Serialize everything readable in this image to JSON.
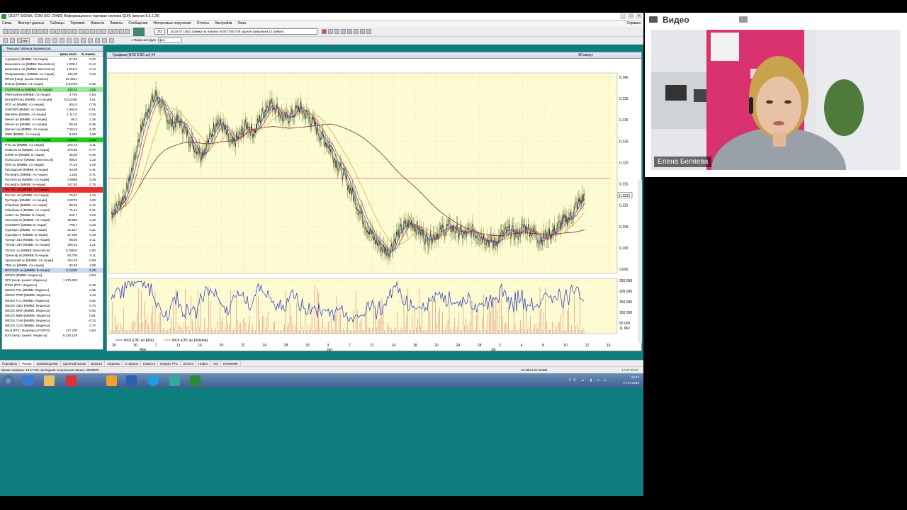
{
  "app": {
    "title": "[30277 SIGNAL-COM UID: 20483] Информационно-торговая система QUIK (версия 6.5.1.28)",
    "menu": [
      "Связь",
      "Экспорт данных",
      "Таблицы",
      "Торговля",
      "Новости",
      "Лимиты",
      "Сообщения",
      "Нетор­говые поручения",
      "Отчеты",
      "Настройки",
      "Окна"
    ],
    "help": "Справка",
    "news_counter": "2/2",
    "news_text": "15:16:47 (162) Заявка на покупку N 9477004728 зарегистрирована (3 заявки)",
    "search_label": "Поиск инструм",
    "search_value": "фск",
    "toolbar_dropdown": "МВБ"
  },
  "table": {
    "title": "Текущая таблица параметров",
    "headers": {
      "name": "",
      "price": "Цена посл.",
      "change": "% измен."
    },
    "rows": [
      {
        "name": "Аэрофлот [ММВБ: А2-Акции]",
        "price": "57,93",
        "change": "0,22"
      },
      {
        "name": "Башнефть ао [ММВБ: Внесписок]",
        "price": "1 005,2",
        "change": "-0,44"
      },
      {
        "name": "Башнефть ап [ММВБ: Внесписок]",
        "price": "2 019,5",
        "change": "0,14"
      },
      {
        "name": "Газпромнефть [ММВБ: А1-Акции]",
        "price": "122,00",
        "change": "0,23"
      },
      {
        "name": "RRUS [неор. рынки: Валюты]",
        "price": "32,4814",
        "change": ""
      },
      {
        "name": "ВТБ ао [ММВБ: А1-Акции]",
        "price": "0,04783",
        "change": "-0,36"
      },
      {
        "name": "ГАЗПРОМ ао [ММВБ: А1-Акции]",
        "price": "128,34",
        "change": "2,85",
        "hl": "#9de89d"
      },
      {
        "name": "ГМКНорНик [ММВБ: А2-Акции]",
        "price": "4 740",
        "change": "0,64"
      },
      {
        "name": "ИнтерРАОао [ММВБ: А1-Акции]",
        "price": "0,013400",
        "change": "1,51"
      },
      {
        "name": "ЛСР ао [ММВБ: А1-Акции]",
        "price": "604,0",
        "change": "0,78"
      },
      {
        "name": "ЛУКОЙЛ [ММВБ: А1-Акции]",
        "price": "1 994,8",
        "change": "-0,01"
      },
      {
        "name": "МегаФон [ММВБ: А1-Акции]",
        "price": "1 117,0",
        "change": "0,34"
      },
      {
        "name": "Мечел ап [ММВБ: А1-Акции]",
        "price": "96,3",
        "change": "1,16"
      },
      {
        "name": "Мечел ао [ММВБ: А1-Акции]",
        "price": "55,69",
        "change": "-0,36"
      },
      {
        "name": "Магнит ао [ММВБ: А1-Акции]",
        "price": "7 311,9",
        "change": "-1,32"
      },
      {
        "name": "ММК [ММВБ: А1-Акции]",
        "price": "8,240",
        "change": "1,98"
      },
      {
        "name": "+Носимаяго [ММВБ: А1-Акции]",
        "price": "1,0543",
        "change": "0,42",
        "hl": "#22cc22"
      },
      {
        "name": "НТС ао [ММВБ: А1-Акции]",
        "price": "272,73",
        "change": "0,11"
      },
      {
        "name": "Новатэк ао [ММВБ: А1-Акции]",
        "price": "370,80",
        "change": "0,77"
      },
      {
        "name": "НЛМК ао [ММВБ: Б-Акции]",
        "price": "46,60",
        "change": "-0,45"
      },
      {
        "name": "ПолюсЗолот [ММВБ: Внесписок]",
        "price": "905,0",
        "change": "1,22"
      },
      {
        "name": "ПИК ао [ММВБ: А1-Акции]",
        "price": "71,10",
        "change": "-1,46"
      },
      {
        "name": "Распадская [ММВБ: Б-Акции]",
        "price": "33,89",
        "change": "0,41"
      },
      {
        "name": "Роснефть [ММВБ: А1-Акции]",
        "price": "1,155",
        "change": "4,71"
      },
      {
        "name": "Россети ао [ММВБ: А2-Акции]",
        "price": "0,8888",
        "change": "2,29"
      },
      {
        "name": "Роснефть [ММВБ: Б-Акции]",
        "price": "247,83",
        "change": "0,75"
      },
      {
        "name": "Ростел- ао [ММВБ: А1-Акции]",
        "price": "",
        "change": "",
        "hl": "#e83030"
      },
      {
        "name": "Ростел- ап [ММВБ: А1-Акции]",
        "price": "76,87",
        "change": "1,12"
      },
      {
        "name": "РусГидро [ММВБ: А1-Акции]",
        "price": "0,5720",
        "change": "1,00"
      },
      {
        "name": "Сбербанк [ММВБ: А1-Акции]",
        "price": "99,59",
        "change": "0,12"
      },
      {
        "name": "Сбербанк-п [ММВБ: А1-Акции]",
        "price": "76,41",
        "change": "0,21"
      },
      {
        "name": "СевСт-ао [ММВБ: Б-Акции]",
        "price": "240,7",
        "change": "2,03"
      },
      {
        "name": "Система ао [ММВБ: А1-Акции]",
        "price": "28,889",
        "change": "-1,45"
      },
      {
        "name": "СОЛЛЕРС [ММВБ: Б-Акции]",
        "price": "708,7",
        "change": "0,33"
      },
      {
        "name": "Сургнфгз [ММВБ: А1-Акции]",
        "price": "21,527",
        "change": "0,21"
      },
      {
        "name": "Сургнфгз-п [ММВБ: Б-Акции]",
        "price": "27,230",
        "change": "0,18"
      },
      {
        "name": "Татнфт 3ао [ММВБ: А1-Акции]",
        "price": "98,80",
        "change": "0,11"
      },
      {
        "name": "Татнфт 3ап [ММВБ: А1-Акции]",
        "price": "200,10",
        "change": "1,21"
      },
      {
        "name": "Таттел. ао [ММВБ: Внесписок]",
        "price": "0,15810",
        "change": "0,60"
      },
      {
        "name": "Транснф ап [ММВБ: Б-Акции]",
        "price": "82,700",
        "change": "0,11"
      },
      {
        "name": "Уралкалий ао [ММВБ: А1-Акции]",
        "price": "214,29",
        "change": "-0,09"
      },
      {
        "name": "ТМК ао [ММВБ: А1-Акции]",
        "price": "92,49",
        "change": "2,98"
      },
      {
        "name": "ФСК ЕЭС ао [ММВБ: Б-Акции]",
        "price": "0,11230",
        "change": "5,35",
        "hl": "#c8d8f0"
      },
      {
        "name": "MICEX [ММВБ: Индексы]",
        "price": "",
        "change": "0,54"
      },
      {
        "name": "SPX [неор. рынки: Индексы]",
        "price": "1 676,260",
        "change": ""
      },
      {
        "name": "RTS2 [РТС: Индексы]",
        "price": "",
        "change": "-0,18"
      },
      {
        "name": "MICEX FNL [ММВБ: Индексы]",
        "price": "",
        "change": "0,36"
      },
      {
        "name": "MICEX PWR [ММВБ: Индексы]",
        "price": "",
        "change": "1,43"
      },
      {
        "name": "MICEX TLC [ММВБ: Индексы]",
        "price": "",
        "change": "0,52"
      },
      {
        "name": "MICEX O&G [ММВБ: Индексы]",
        "price": "",
        "change": "0,73"
      },
      {
        "name": "MICEX MNF [ММВБ: Индексы]",
        "price": "",
        "change": "-0,02"
      },
      {
        "name": "MICEX M&M [ММВБ: Индексы]",
        "price": "",
        "change": "0,81"
      },
      {
        "name": "MICEX CHM [ММВБ: Индексы]",
        "price": "",
        "change": "-0,13"
      },
      {
        "name": "MICEX CGS [ММВБ: Индексы]",
        "price": "",
        "change": "0,72"
      },
      {
        "name": "RIU3 [РТС: Фьючерсы FORTS]",
        "price": "137 200",
        "change": "0,53"
      },
      {
        "name": "DAX [неор. рынки: Индексы]",
        "price": "8 220,129",
        "change": ""
      }
    ]
  },
  "chart_window": {
    "title": "Графики [ФСК ЕЭС ао] #4",
    "timeframe": "60 минут"
  },
  "chart_data": {
    "type": "line",
    "price_axis": {
      "ylim": [
        0.094,
        0.141
      ],
      "ticks": [
        "0,140",
        "0,135",
        "0,130",
        "0,125",
        "0,120",
        "0,115",
        "0,110",
        "0,105",
        "0,100",
        "0,095"
      ],
      "last_price": "0,1123"
    },
    "volume_axis": {
      "ylim": [
        0,
        260000
      ],
      "ticks": [
        "250 000",
        "200 000",
        "150 000",
        "100 000",
        "50 000"
      ],
      "last_volume": "11 962"
    },
    "horizontal_level": 0.1163,
    "x_tick_labels": [
      "26",
      "30",
      "7",
      "13",
      "16",
      "20",
      "22",
      "24",
      "28",
      "30",
      "3",
      "7",
      "11",
      "14",
      "18",
      "20",
      "24",
      "28",
      "2",
      "4",
      "8",
      "10",
      "12",
      "16"
    ],
    "month_labels": [
      "May",
      "Jun",
      "Jul"
    ],
    "series": [
      {
        "name": "ФСК ЕЭС ао [RSI]",
        "values": []
      },
      {
        "name": "ФСК ЕЭС ао [Volume]",
        "values": []
      }
    ],
    "price_path": [
      0.108,
      0.11,
      0.113,
      0.12,
      0.128,
      0.133,
      0.136,
      0.132,
      0.129,
      0.13,
      0.127,
      0.124,
      0.122,
      0.125,
      0.13,
      0.128,
      0.124,
      0.126,
      0.129,
      0.127,
      0.131,
      0.134,
      0.133,
      0.13,
      0.131,
      0.133,
      0.131,
      0.129,
      0.126,
      0.124,
      0.12,
      0.117,
      0.113,
      0.109,
      0.105,
      0.102,
      0.1,
      0.099,
      0.103,
      0.105,
      0.106,
      0.104,
      0.102,
      0.103,
      0.104,
      0.105,
      0.104,
      0.103,
      0.104,
      0.103,
      0.102,
      0.101,
      0.103,
      0.104,
      0.103,
      0.105,
      0.104,
      0.102,
      0.103,
      0.104,
      0.106,
      0.107,
      0.11,
      0.112
    ]
  },
  "tabs": [
    "Портфель",
    "Рынки",
    "Заявки/сделки",
    "Срочный рынок",
    "Валюта",
    "опционы",
    "2 оценок",
    "Новости",
    "Индекс РТС",
    "Золото",
    "Нефть",
    "VIX",
    "Нелинейн"
  ],
  "status": {
    "left": "Время сервера: 15:17:28; последняя полученная запись: 5800975",
    "middle": "10.100.3.11:15186",
    "date": "17.07.2013"
  },
  "taskbar": {
    "time": "15:17",
    "date": "17.07.2013",
    "lang": "EN"
  },
  "video": {
    "title": "Видео",
    "speaker": "Елена Беляева"
  },
  "colors": {
    "chart_bg": "#fdfbd2",
    "price_line": "#1a1a1a",
    "ma_blue": "#2244cc",
    "ma_red": "#dd3333",
    "ma_orange": "#e0a040",
    "ma_brown": "#6b2f2f",
    "level_line": "#e060a0",
    "rsi": "#2233bb",
    "volume": "#d07060",
    "desktop": "#0e7d7d"
  }
}
